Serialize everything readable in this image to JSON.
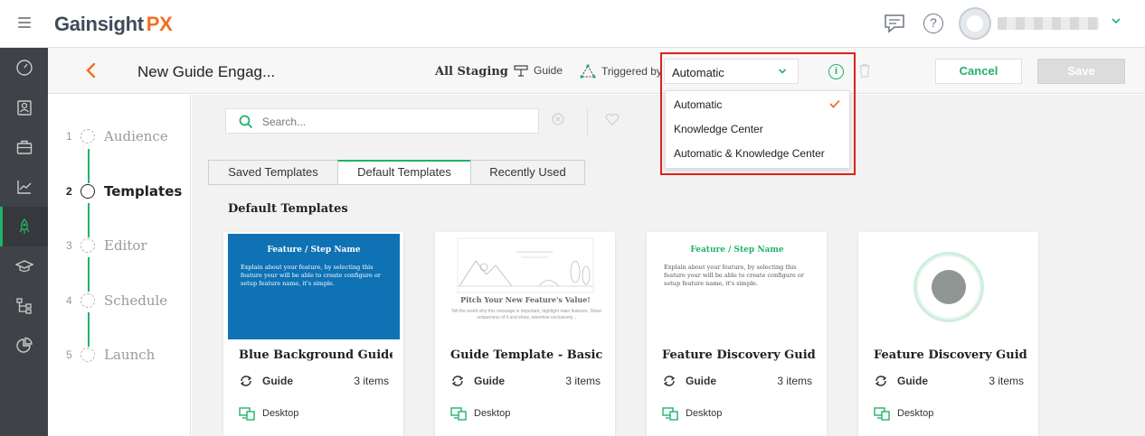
{
  "app": {
    "logo_name": "Gainsight",
    "logo_suffix": "PX"
  },
  "header": {
    "help_label": "?"
  },
  "subheader": {
    "title": "New Guide Engag...",
    "environment": "All Staging",
    "guide_type": "Guide",
    "triggered_by_label": "Triggered by",
    "trigger_value": "Automatic",
    "info_label": "i",
    "cancel_label": "Cancel",
    "save_label": "Save"
  },
  "trigger_dropdown": {
    "options": [
      "Automatic",
      "Knowledge Center",
      "Automatic & Knowledge Center"
    ],
    "selected": "Automatic"
  },
  "steps": [
    {
      "num": "1",
      "label": "Audience"
    },
    {
      "num": "2",
      "label": "Templates"
    },
    {
      "num": "3",
      "label": "Editor"
    },
    {
      "num": "4",
      "label": "Schedule"
    },
    {
      "num": "5",
      "label": "Launch"
    }
  ],
  "search": {
    "placeholder": "Search..."
  },
  "tabs": [
    "Saved Templates",
    "Default Templates",
    "Recently Used"
  ],
  "section_title": "Default Templates",
  "cards": [
    {
      "title": "Blue Background Guide T...",
      "type": "Guide",
      "count": "3 items",
      "device": "Desktop",
      "thumb_heading": "Feature / Step Name",
      "thumb_body": "Explain about your feature, by selecting this feature your will be able to create configure or setup feature name, it's simple."
    },
    {
      "title": "Guide Template - Basic",
      "type": "Guide",
      "count": "3 items",
      "device": "Desktop",
      "thumb_heading": "Pitch Your New Feature's Value!",
      "thumb_body": "Tell the world why this message is important, highlight main features. Show uniqueness of it and show, advertise exclusively..."
    },
    {
      "title": "Feature Discovery Guide T...",
      "type": "Guide",
      "count": "3 items",
      "device": "Desktop",
      "thumb_heading": "Feature / Step Name",
      "thumb_body": "Explain about your feature, by selecting this feature your will be able to create configure or setup feature name, it's simple."
    },
    {
      "title": "Feature Discovery Guide T...",
      "type": "Guide",
      "count": "3 items",
      "device": "Desktop"
    }
  ],
  "colors": {
    "accent": "#21b26b",
    "brand_orange": "#f26f21",
    "highlight": "#e0201b",
    "sidebar": "#3f4246",
    "blue_template": "#0e72b5"
  },
  "icons": [
    "hamburger-icon",
    "chat-icon",
    "help-icon",
    "chevron-down-icon",
    "back-arrow-icon",
    "guide-icon",
    "trigger-icon",
    "info-icon",
    "trash-icon",
    "search-icon",
    "clear-icon",
    "heart-icon",
    "check-icon",
    "guide-cycle-icon",
    "desktop-icon"
  ]
}
